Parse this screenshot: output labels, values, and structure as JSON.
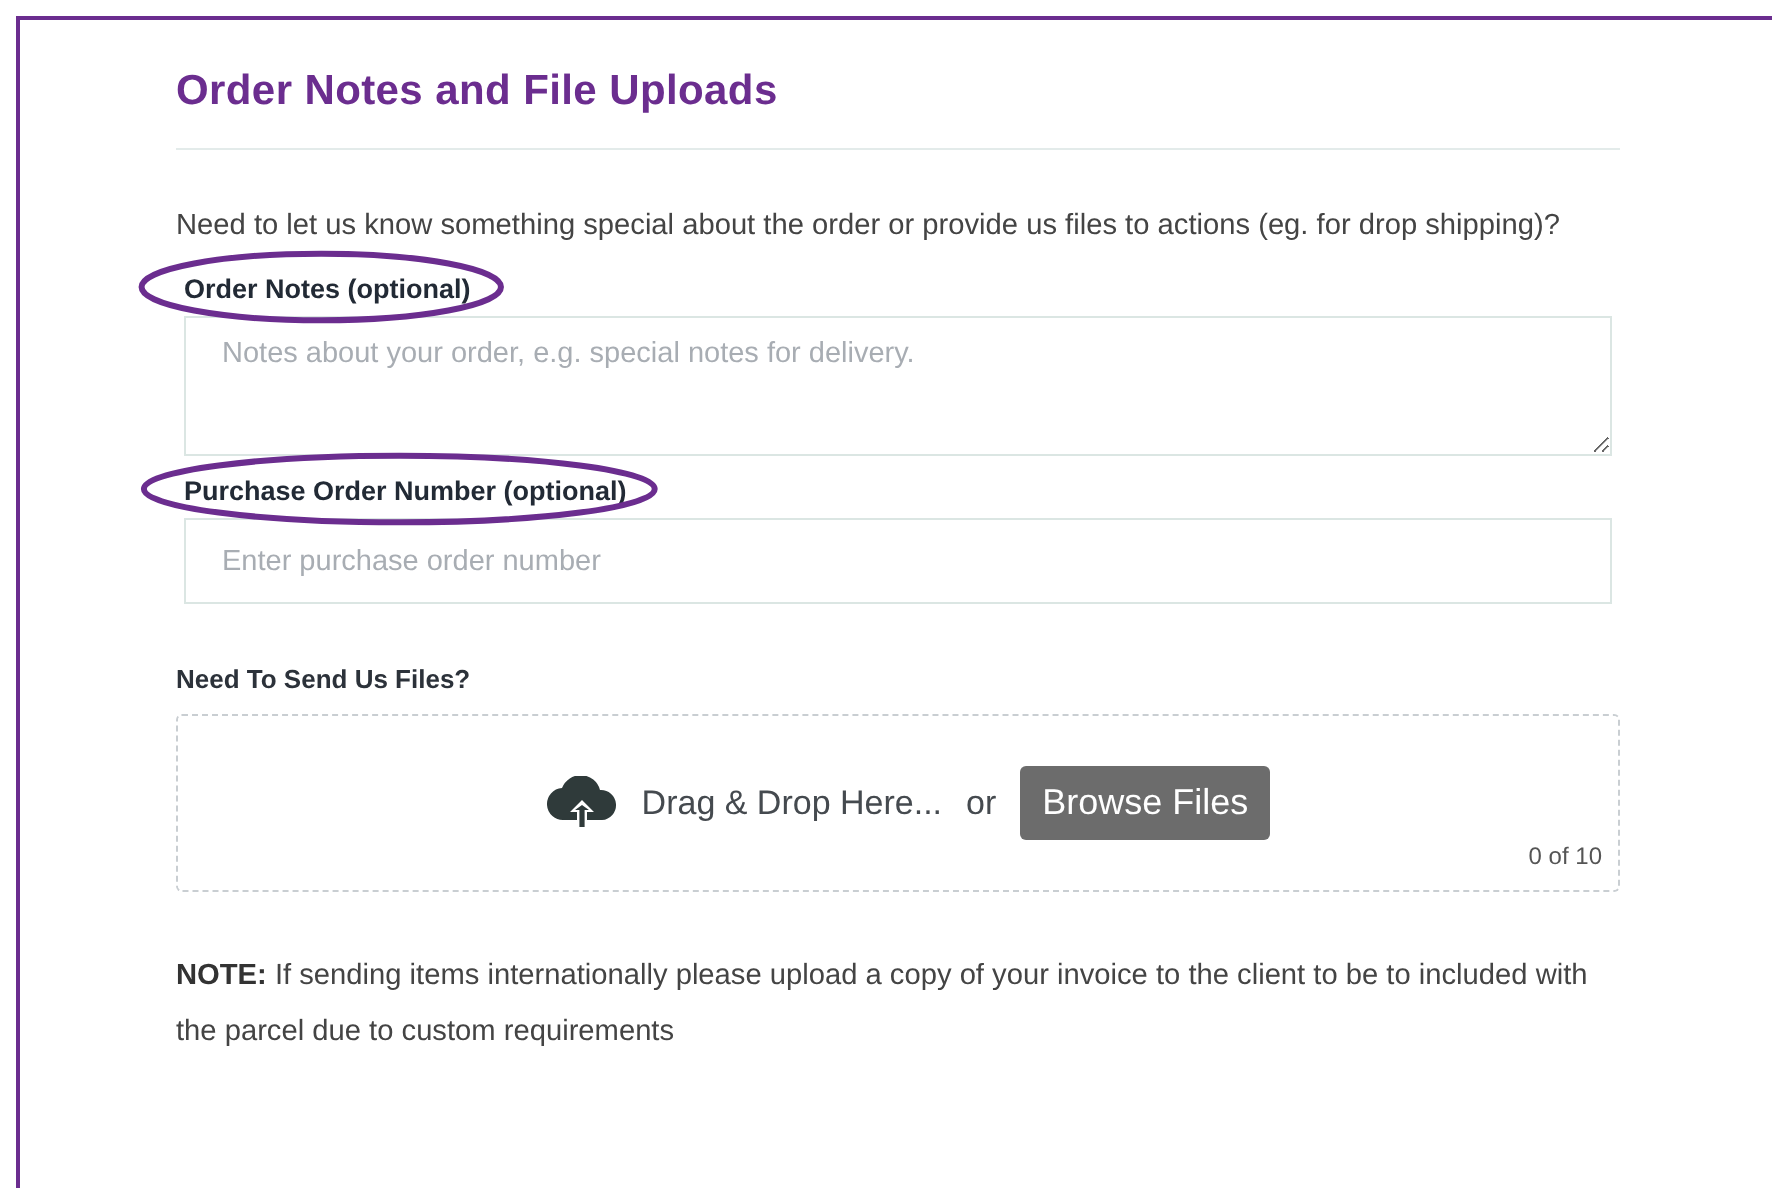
{
  "section": {
    "title": "Order Notes and File Uploads",
    "intro": "Need to let us know something special about the order or provide us files to actions (eg. for drop shipping)?"
  },
  "fields": [
    {
      "kind": "textarea",
      "label": "Order Notes (optional)",
      "placeholder": "Notes about your order, e.g. special notes for delivery.",
      "circled": true
    },
    {
      "kind": "input",
      "label": "Purchase Order Number (optional)",
      "placeholder": "Enter purchase order number",
      "circled": true
    }
  ],
  "upload": {
    "label": "Need To Send Us Files?",
    "drop_text": "Drag & Drop Here...",
    "or_text": "or",
    "button": "Browse Files",
    "count": "0 of 10"
  },
  "note": "**NOTE:** If sending items internationally please upload a copy of your invoice to the client to be to included with the parcel due to custom requirements"
}
